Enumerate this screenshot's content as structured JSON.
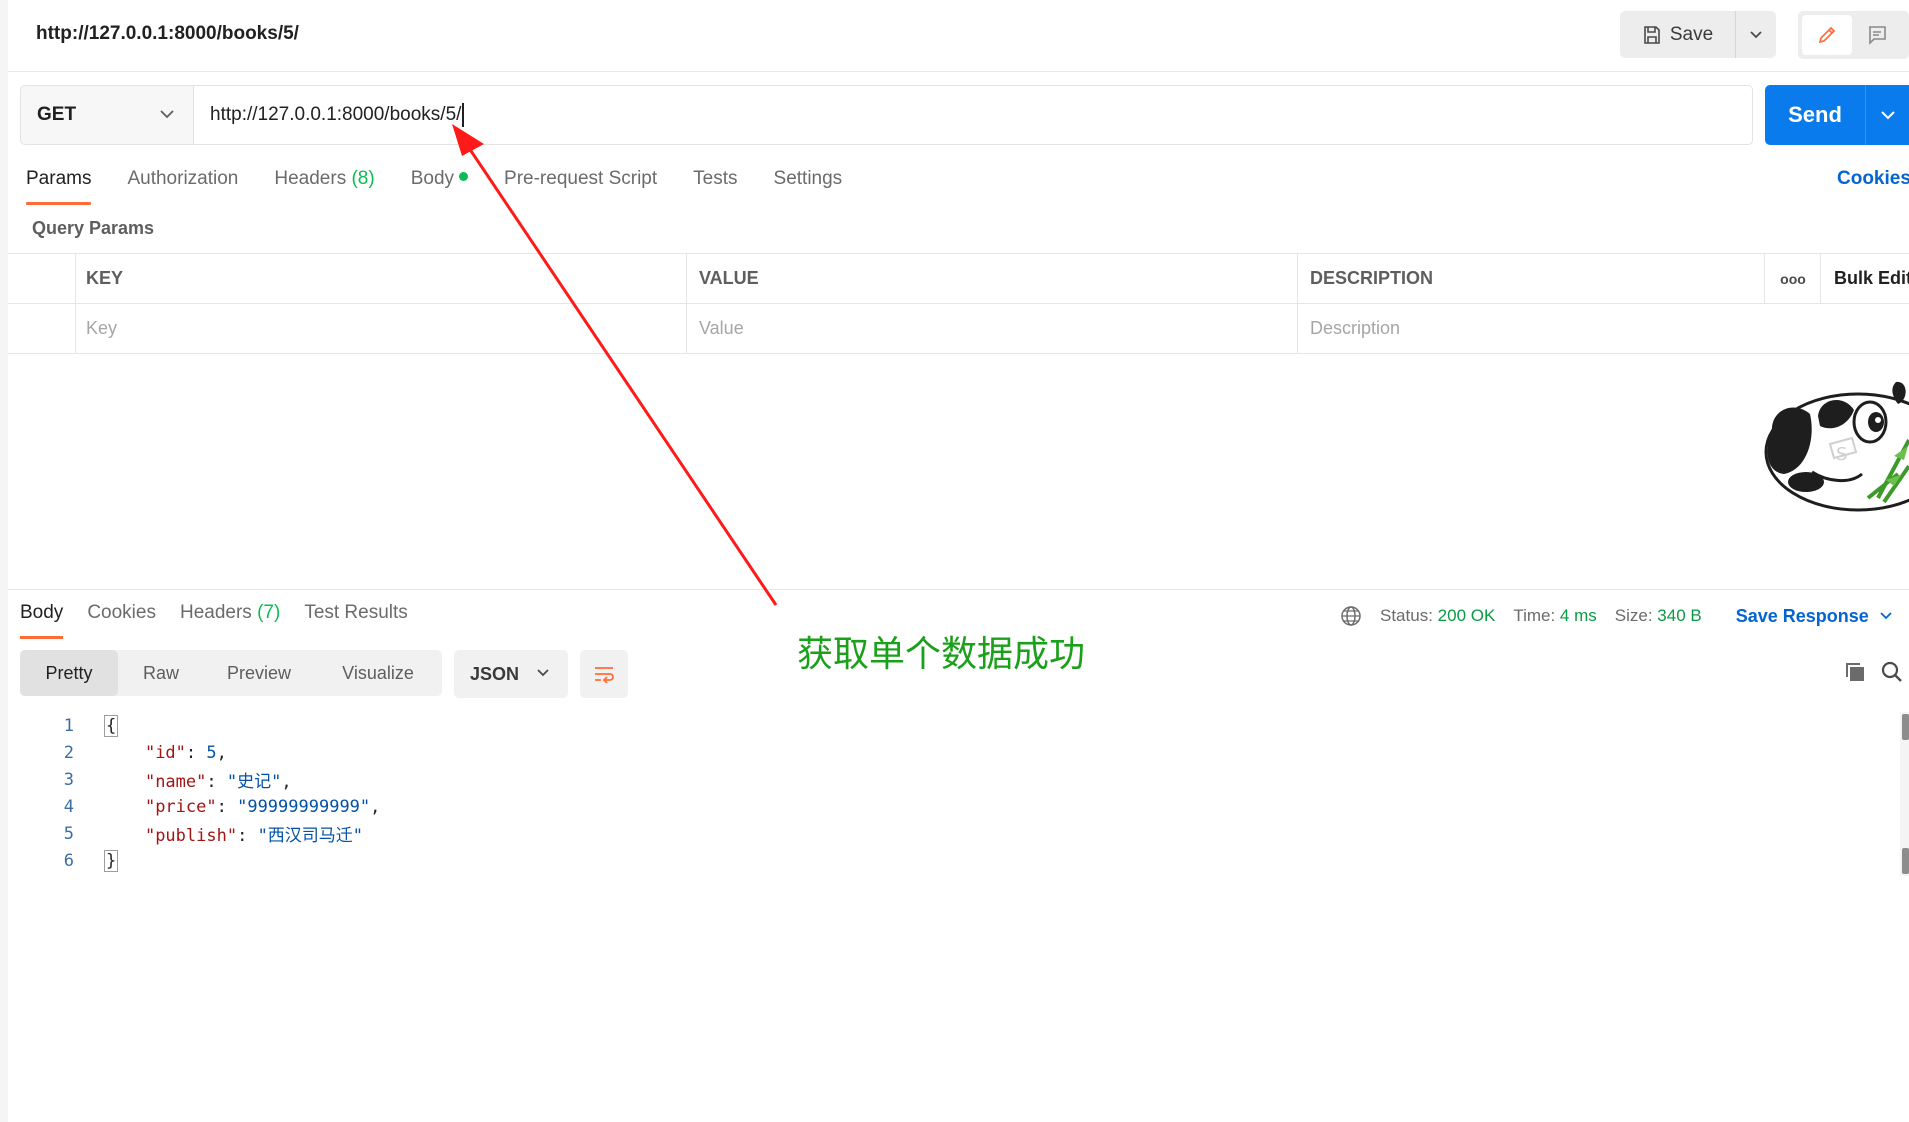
{
  "header": {
    "request_title": "http://127.0.0.1:8000/books/5/",
    "save_label": "Save",
    "icons": {
      "save": "save-disk-icon",
      "dropdown": "chevron-down-icon",
      "edit": "pencil-icon",
      "doc": "comment-icon"
    },
    "accent_color": "#ff6c37"
  },
  "request": {
    "method": "GET",
    "url": "http://127.0.0.1:8000/books/5/",
    "send_label": "Send",
    "send_color": "#097bed",
    "tabs": [
      {
        "label": "Params",
        "active": true
      },
      {
        "label": "Authorization"
      },
      {
        "label": "Headers",
        "count": "(8)"
      },
      {
        "label": "Body",
        "dot": true
      },
      {
        "label": "Pre-request Script"
      },
      {
        "label": "Tests"
      },
      {
        "label": "Settings"
      }
    ],
    "cookies_label": "Cookies",
    "query_params_label": "Query Params",
    "params_table": {
      "columns": [
        "KEY",
        "VALUE",
        "DESCRIPTION"
      ],
      "more_label": "ooo",
      "bulk_edit_label": "Bulk Edit",
      "placeholders": [
        "Key",
        "Value",
        "Description"
      ]
    }
  },
  "response": {
    "tabs": [
      {
        "label": "Body",
        "active": true
      },
      {
        "label": "Cookies"
      },
      {
        "label": "Headers",
        "count": "(7)"
      },
      {
        "label": "Test Results"
      }
    ],
    "status": {
      "label": "Status:",
      "value": "200 OK"
    },
    "time": {
      "label": "Time:",
      "value": "4 ms"
    },
    "size": {
      "label": "Size:",
      "value": "340 B"
    },
    "save_response_label": "Save Response",
    "view_modes": [
      "Pretty",
      "Raw",
      "Preview",
      "Visualize"
    ],
    "active_view": "Pretty",
    "format": "JSON",
    "code_lines": [
      {
        "n": "1",
        "text": "{"
      },
      {
        "n": "2",
        "key": "\"id\"",
        "value": "5",
        "trail": ","
      },
      {
        "n": "3",
        "key": "\"name\"",
        "value": "\"史记\"",
        "trail": ","
      },
      {
        "n": "4",
        "key": "\"price\"",
        "value": "\"99999999999\"",
        "trail": ","
      },
      {
        "n": "5",
        "key": "\"publish\"",
        "value": "\"西汉司马迁\"",
        "trail": ""
      },
      {
        "n": "6",
        "text": "}"
      }
    ]
  },
  "annotation": {
    "text": "获取单个数据成功",
    "color": "#1aa01a",
    "arrow_color": "#ff1a1a"
  }
}
